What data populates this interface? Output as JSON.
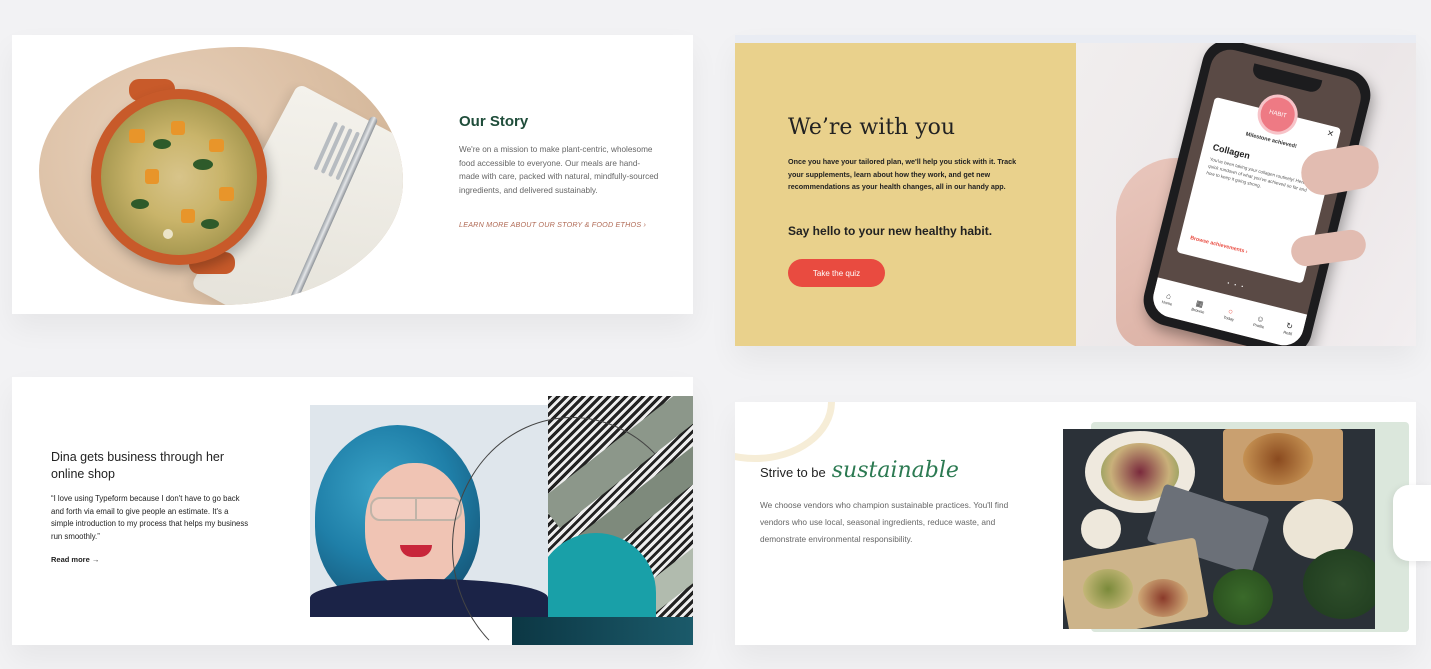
{
  "cards": {
    "story": {
      "title": "Our Story",
      "body": "We're on a mission to make plant-centric, wholesome food accessible to everyone. Our meals are hand-made with care, packed with natural, mindfully-sourced ingredients, and delivered sustainably.",
      "link": "LEARN MORE ABOUT OUR STORY & FOOD ETHOS ›"
    },
    "withyou": {
      "title": "We’re with you",
      "body": "Once you have your tailored plan, we'll help you stick with it. Track your supplements, learn about how they work, and get new recommendations as your health changes, all in our handy app.",
      "subtitle": "Say hello to your new healthy habit.",
      "button": "Take the quiz",
      "phone": {
        "badge": "HABIT",
        "close": "×",
        "achievement": "Milestone achieved!",
        "title": "Collagen",
        "body": "You've been taking your collagen routinely! Here's a quick rundown of what you've achieved so far and how to keep it going strong.",
        "link": "Browse achievements ›",
        "pager": "• • •",
        "tabs": [
          {
            "icon": "home-icon",
            "glyph": "⌂",
            "label": "Home"
          },
          {
            "icon": "grid-icon",
            "glyph": "▦",
            "label": "Browse"
          },
          {
            "icon": "circle-icon",
            "glyph": "○",
            "label": "Today"
          },
          {
            "icon": "person-icon",
            "glyph": "☺",
            "label": "Profile"
          },
          {
            "icon": "refresh-icon",
            "glyph": "↻",
            "label": "Refill"
          }
        ]
      }
    },
    "dina": {
      "title": "Dina gets business through her online shop",
      "quote": "“I love using Typeform because I don't have to go back and forth via email to give people an estimate. It's a simple introduction to my process that helps my business run smoothly.”",
      "link": "Read more →"
    },
    "sustainable": {
      "title_plain": "Strive to be",
      "title_script": "sustainable",
      "body": "We choose vendors who champion sustainable practices. You'll find vendors who use local, seasonal ingredients, reduce waste, and demonstrate environmental responsibility."
    }
  },
  "colors": {
    "story_green": "#1f4d3a",
    "link_rose": "#b06a55",
    "yellow_panel": "#e9d18c",
    "cta_red": "#e94b40",
    "script_green": "#2c7a52",
    "teal": "#19a0a8"
  }
}
